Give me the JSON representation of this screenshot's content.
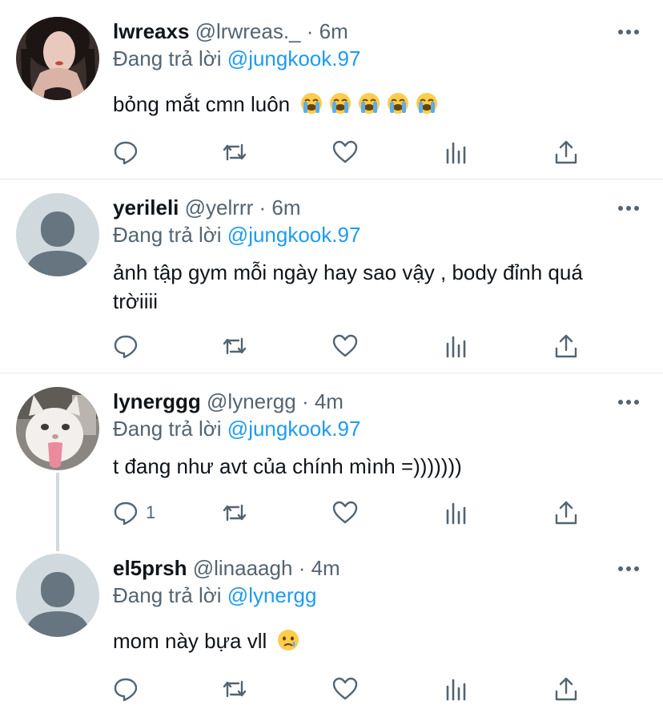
{
  "colors": {
    "accent": "#1d9bf0",
    "meta": "#536471",
    "text": "#0f1419",
    "divider": "#e1e8ed"
  },
  "tweets": [
    {
      "name": "lwreaxs",
      "handle": "@lrwreas._",
      "time": "· 6m",
      "replying_prefix": "Đang trả lời",
      "replying_to": "@jungkook.97",
      "text": "bỏng mắt cmn luôn",
      "emoji": [
        "loudly-crying-face",
        "loudly-crying-face",
        "loudly-crying-face",
        "loudly-crying-face",
        "loudly-crying-face"
      ],
      "avatar": "photo-person",
      "reply_count": ""
    },
    {
      "name": "yerileli",
      "handle": "@yelrrr",
      "time": "· 6m",
      "replying_prefix": "Đang trả lời",
      "replying_to": "@jungkook.97",
      "text": "ảnh tập gym mỗi ngày hay sao vậy , body đỉnh quá trờiiii",
      "avatar": "default-avatar",
      "reply_count": ""
    },
    {
      "name": "lynerggg",
      "handle": "@lynergg",
      "time": "· 4m",
      "replying_prefix": "Đang trả lời",
      "replying_to": "@jungkook.97",
      "text": "t đang như avt của chính mình =)))))))",
      "avatar": "photo-cat",
      "reply_count": "1"
    },
    {
      "name": "el5prsh",
      "handle": "@linaaagh",
      "time": "· 4m",
      "replying_prefix": "Đang trả lời",
      "replying_to": "@lynergg",
      "text": "mom này bựa vll",
      "emoji": [
        "crying-face"
      ],
      "avatar": "default-avatar",
      "reply_count": ""
    }
  ]
}
